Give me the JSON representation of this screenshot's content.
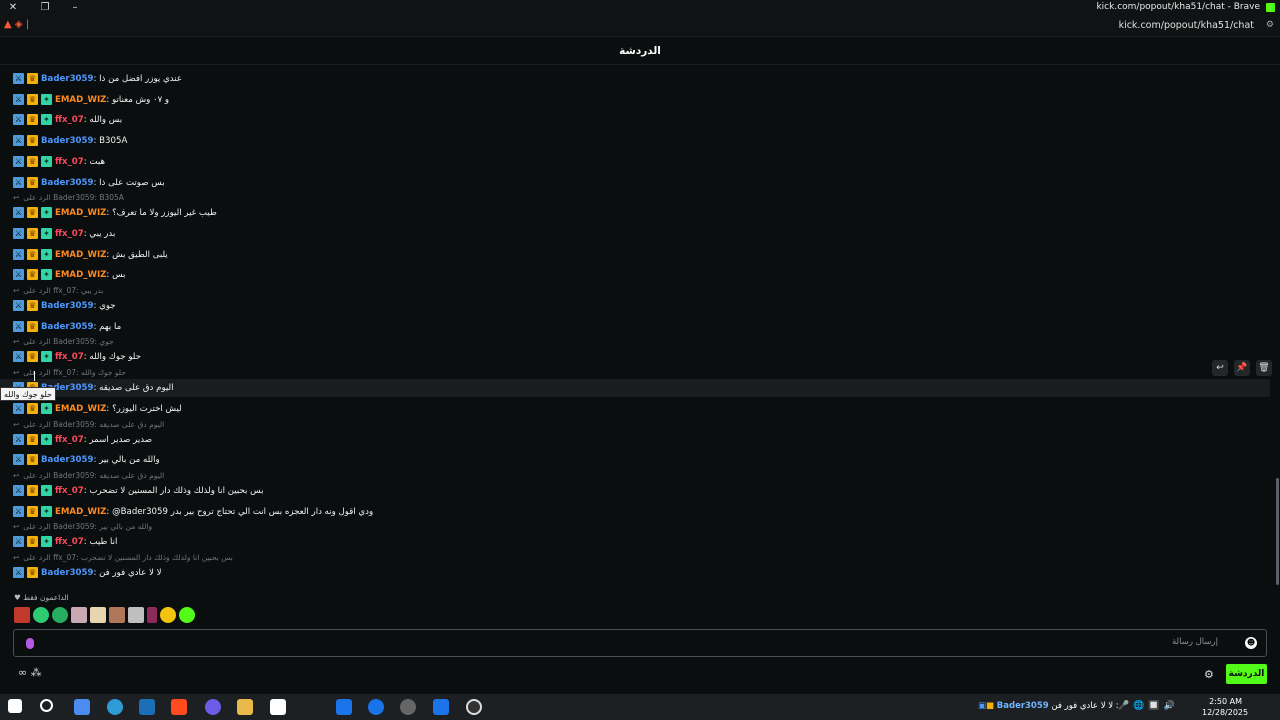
{
  "window": {
    "title": "kick.com/popout/kha51/chat - Brave",
    "url": "kick.com/popout/kha51/chat"
  },
  "header": {
    "title": "الدردشة"
  },
  "colors": {
    "accent": "#53fc18",
    "user_blue": "#4c98ff",
    "user_orange": "#ff8a1f",
    "user_red": "#ff4a5a"
  },
  "messages": [
    {
      "user": "Bader3059",
      "color": "blue",
      "badges": [
        "mod",
        "crown"
      ],
      "text": "عندي يوزر افضل من ذا"
    },
    {
      "user": "EMAD_WIZ",
      "color": "orange",
      "badges": [
        "mod",
        "crown",
        "sub"
      ],
      "text": "و ٠٧ وش معناتو"
    },
    {
      "user": "ffx_07",
      "color": "red",
      "badges": [
        "mod",
        "crown",
        "sub"
      ],
      "text": "بس والله"
    },
    {
      "user": "Bader3059",
      "color": "blue",
      "badges": [
        "mod",
        "crown"
      ],
      "text": "B305A"
    },
    {
      "user": "ffx_07",
      "color": "red",
      "badges": [
        "mod",
        "crown",
        "sub"
      ],
      "text": "هبت"
    },
    {
      "user": "Bader3059",
      "color": "blue",
      "badges": [
        "mod",
        "crown"
      ],
      "text": "بس صوتت على ذا"
    },
    {
      "reply": "الرد على Bader3059: B305A"
    },
    {
      "user": "EMAD_WIZ",
      "color": "orange",
      "badges": [
        "mod",
        "crown",
        "sub"
      ],
      "text": "طيب غير اليوزر ولا ما تعرف؟"
    },
    {
      "user": "ffx_07",
      "color": "red",
      "badges": [
        "mod",
        "crown",
        "sub"
      ],
      "text": "بدر يبي"
    },
    {
      "user": "EMAD_WIZ",
      "color": "orange",
      "badges": [
        "mod",
        "crown",
        "sub"
      ],
      "text": "يلبى الطيق بش"
    },
    {
      "user": "EMAD_WIZ",
      "color": "orange",
      "badges": [
        "mod",
        "crown",
        "sub"
      ],
      "text": "بس"
    },
    {
      "reply": "الرد على ffx_07: بدر يبي"
    },
    {
      "user": "Bader3059",
      "color": "blue",
      "badges": [
        "mod",
        "crown"
      ],
      "text": "جوي"
    },
    {
      "user": "Bader3059",
      "color": "blue",
      "badges": [
        "mod",
        "crown"
      ],
      "text": "ما يهم"
    },
    {
      "reply": "الرد على Bader3059: جوي"
    },
    {
      "user": "ffx_07",
      "color": "red",
      "badges": [
        "mod",
        "crown",
        "sub"
      ],
      "text": "حلو جوك والله"
    },
    {
      "reply": "الرد على ffx_07: حلو جوك والله"
    },
    {
      "user": "Bader3059",
      "color": "blue",
      "badges": [
        "mod",
        "crown"
      ],
      "text": "اليوم دق على صديقه"
    },
    {
      "user": "EMAD_WIZ",
      "color": "orange",
      "badges": [
        "mod",
        "crown",
        "sub"
      ],
      "text": "ليش اخترت اليوزر؟"
    },
    {
      "reply": "الرد على Bader3059: اليوم دق على صديقه"
    },
    {
      "user": "ffx_07",
      "color": "red",
      "badges": [
        "mod",
        "crown",
        "sub"
      ],
      "text": "صدير صدير اسمر"
    },
    {
      "user": "Bader3059",
      "color": "blue",
      "badges": [
        "mod",
        "crown"
      ],
      "text": "والله من بالي بير"
    },
    {
      "reply": "الرد على Bader3059: اليوم دق على صديقه"
    },
    {
      "user": "ffx_07",
      "color": "red",
      "badges": [
        "mod",
        "crown",
        "sub"
      ],
      "text": "بس بحبين انا ولذلك وذلك دار المسنين لا تضحرب"
    },
    {
      "user": "EMAD_WIZ",
      "color": "orange",
      "badges": [
        "mod",
        "crown",
        "sub"
      ],
      "text": "@Bader3059 ودي اقول ونه دار العجزه بس انت الي تحتاج تروح بير بدر"
    },
    {
      "reply": "الرد على Bader3059: والله من بالي بير"
    },
    {
      "user": "ffx_07",
      "color": "red",
      "badges": [
        "mod",
        "crown",
        "sub"
      ],
      "text": "انا طيب"
    },
    {
      "reply": "الرد على ffx_07: بس بحبين انا ولذلك وذلك دار المسنين لا تضحرب"
    },
    {
      "user": "Bader3059",
      "color": "blue",
      "badges": [
        "mod",
        "crown"
      ],
      "text": "لا لا عادي فور فن"
    }
  ],
  "tooltip": "حلو جوك والله",
  "supporters": {
    "label": "الداعمون فقط"
  },
  "input": {
    "placeholder": "إرسال رسالة"
  },
  "bottom": {
    "chat_button": "الدردشة"
  },
  "taskbar": {
    "notif_user": "Bader3059",
    "notif_text": "لا لا عادي فور فن :",
    "time": "2:50 AM",
    "date": "12/28/2025"
  }
}
